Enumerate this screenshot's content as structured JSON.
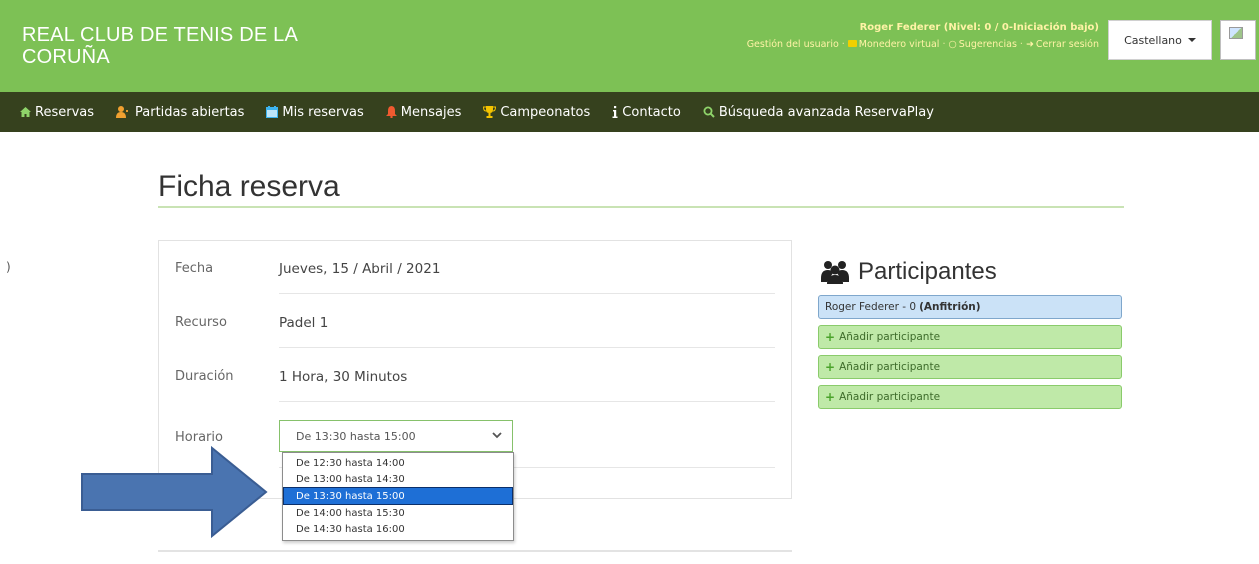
{
  "header": {
    "brand": "REAL CLUB DE TENIS DE LA CORUÑA",
    "user_name": "Roger Federer (Nivel: 0 / 0-Iniciación bajo)",
    "links": [
      "Gestión del usuario",
      "Monedero virtual",
      "Sugerencias",
      "Cerrar sesión"
    ],
    "language": "Castellano"
  },
  "nav": [
    {
      "label": "Reservas",
      "icon": "home-icon"
    },
    {
      "label": "Partidas abiertas",
      "icon": "users-icon"
    },
    {
      "label": "Mis reservas",
      "icon": "calendar-icon"
    },
    {
      "label": "Mensajes",
      "icon": "bell-icon"
    },
    {
      "label": "Campeonatos",
      "icon": "trophy-icon"
    },
    {
      "label": "Contacto",
      "icon": "info-icon"
    },
    {
      "label": "Búsqueda avanzada ReservaPlay",
      "icon": "search-icon"
    }
  ],
  "page": {
    "title": "Ficha reserva",
    "left_mark": ")"
  },
  "reservation": {
    "rows": [
      {
        "label": "Fecha",
        "value": "Jueves, 15 / Abril / 2021"
      },
      {
        "label": "Recurso",
        "value": "Padel 1"
      },
      {
        "label": "Duración",
        "value": "1 Hora, 30 Minutos"
      },
      {
        "label": "Horario",
        "value": ""
      }
    ],
    "schedule": {
      "selected": "De 13:30 hasta 15:00",
      "options": [
        "De 12:30 hasta 14:00",
        "De 13:00 hasta 14:30",
        "De 13:30 hasta 15:00",
        "De 14:00 hasta 15:30",
        "De 14:30 hasta 16:00"
      ],
      "selected_index": 2
    }
  },
  "participants": {
    "title": "Participantes",
    "host": {
      "name": "Roger Federer - 0",
      "role": "(Anfitrión)"
    },
    "add_label": "Añadir participante",
    "add_slots": 3
  },
  "colors": {
    "header_bg": "#7dc155",
    "nav_bg": "#36411e",
    "arrow": "#4a74b0",
    "selected_option": "#1e6fd6"
  }
}
